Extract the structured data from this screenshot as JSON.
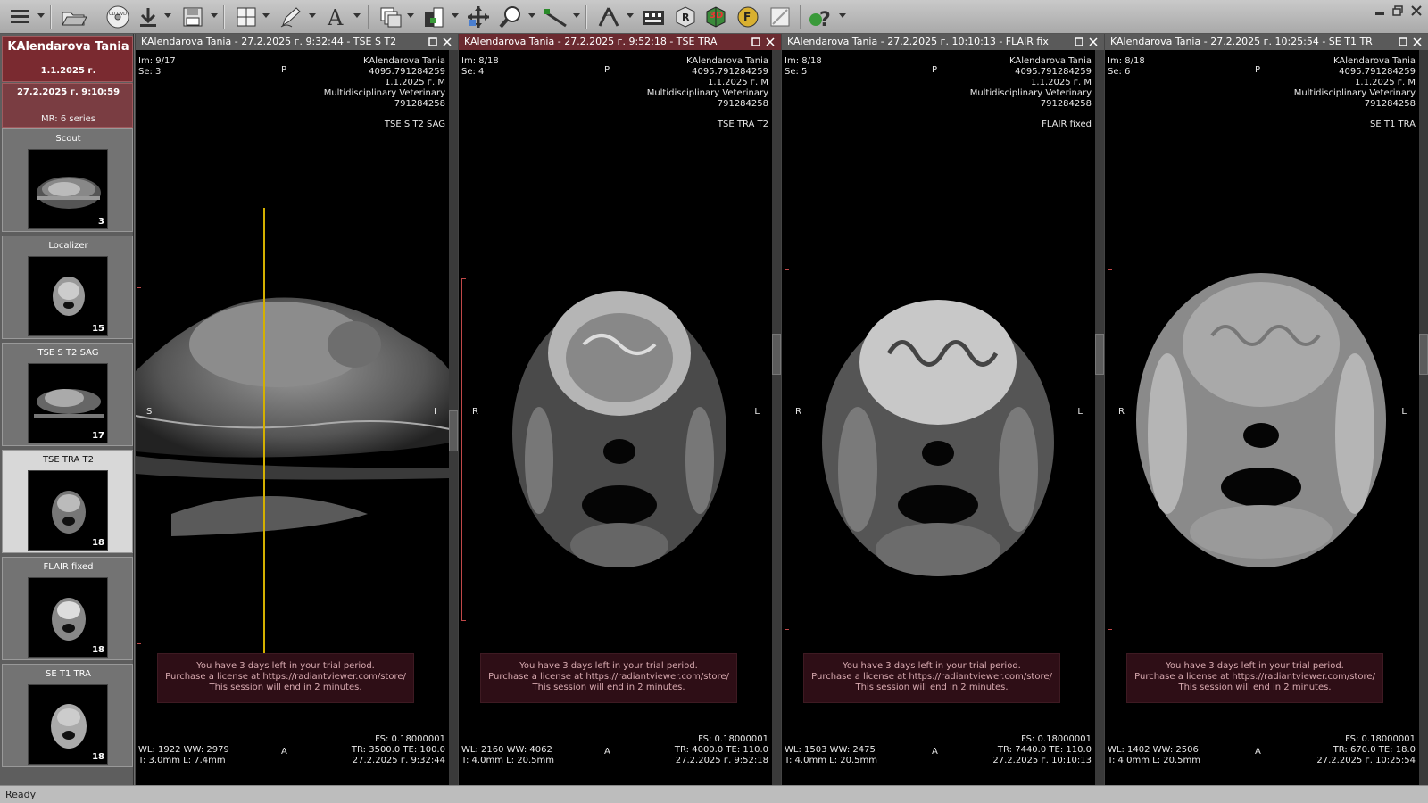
{
  "toolbar": {
    "icons": [
      "menu-icon",
      "open-folder-icon",
      "cd-dvd-icon",
      "download-icon",
      "save-icon",
      "layout-grid-icon",
      "annotate-pen-icon",
      "text-icon",
      "series-stack-icon",
      "window-level-icon",
      "pan-icon",
      "zoom-icon",
      "measure-ruler-icon",
      "angle-icon",
      "cine-icon",
      "mpr-icon",
      "3d-icon",
      "fusion-icon",
      "reset-icon",
      "help-icon"
    ],
    "cd_label": "CD DVD",
    "mpr_label": "R",
    "threed_label": "3D",
    "fusion_label": "F"
  },
  "sidebar": {
    "patient_name": "KAlendarova Tania",
    "patient_dob": "1.1.2025 г.",
    "study_datetime": "27.2.2025 г. 9:10:59",
    "study_series": "MR: 6 series",
    "series": [
      {
        "label": "Scout",
        "count": "3"
      },
      {
        "label": "Localizer",
        "count": "15"
      },
      {
        "label": "TSE S T2 SAG",
        "count": "17"
      },
      {
        "label": "TSE TRA  T2",
        "count": "18"
      },
      {
        "label": "FLAIR fixed",
        "count": "18"
      },
      {
        "label": "SE T1 TRA",
        "count": "18"
      }
    ]
  },
  "trial_message": {
    "line1": "You have 3 days left in your trial period.",
    "line2": "Purchase a license at https://radiantviewer.com/store/",
    "line3": "This session will end in 2 minutes."
  },
  "viewports": [
    {
      "title": "KAlendarova Tania - 27.2.2025 г. 9:32:44 - TSE S T2",
      "im": "Im: 9/17",
      "se": "Se: 3",
      "top_orient": "P",
      "name": "KAlendarova Tania",
      "id": "4095.791284259",
      "dob_sex": "1.1.2025 г. M",
      "institution": "Multidisciplinary Veterinary",
      "acc": "791284258",
      "series_desc": "TSE S T2 SAG",
      "left_orient": "S",
      "right_orient": "I",
      "bottom_orient": "A",
      "fs": "FS: 0.18000001",
      "wl": "WL: 1922 WW: 2979",
      "tr": "TR: 3500.0 TE: 100.0",
      "t": "T: 3.0mm L: 7.4mm",
      "date": "27.2.2025 г. 9:32:44"
    },
    {
      "title": "KAlendarova Tania - 27.2.2025 г. 9:52:18 - TSE TRA",
      "im": "Im: 8/18",
      "se": "Se: 4",
      "top_orient": "P",
      "name": "KAlendarova Tania",
      "id": "4095.791284259",
      "dob_sex": "1.1.2025 г. M",
      "institution": "Multidisciplinary Veterinary",
      "acc": "791284258",
      "series_desc": "TSE TRA  T2",
      "left_orient": "R",
      "right_orient": "L",
      "bottom_orient": "A",
      "fs": "FS: 0.18000001",
      "wl": "WL: 2160 WW: 4062",
      "tr": "TR: 4000.0 TE: 110.0",
      "t": "T: 4.0mm L: 20.5mm",
      "date": "27.2.2025 г. 9:52:18"
    },
    {
      "title": "KAlendarova Tania - 27.2.2025 г. 10:10:13 - FLAIR fix",
      "im": "Im: 8/18",
      "se": "Se: 5",
      "top_orient": "P",
      "name": "KAlendarova Tania",
      "id": "4095.791284259",
      "dob_sex": "1.1.2025 г. M",
      "institution": "Multidisciplinary Veterinary",
      "acc": "791284258",
      "series_desc": "FLAIR fixed",
      "left_orient": "R",
      "right_orient": "L",
      "bottom_orient": "A",
      "fs": "FS: 0.18000001",
      "wl": "WL: 1503 WW: 2475",
      "tr": "TR: 7440.0 TE: 110.0",
      "t": "T: 4.0mm L: 20.5mm",
      "date": "27.2.2025 г. 10:10:13"
    },
    {
      "title": "KAlendarova Tania - 27.2.2025 г. 10:25:54 - SE T1 TR",
      "im": "Im: 8/18",
      "se": "Se: 6",
      "top_orient": "P",
      "name": "KAlendarova Tania",
      "id": "4095.791284259",
      "dob_sex": "1.1.2025 г. M",
      "institution": "Multidisciplinary Veterinary",
      "acc": "791284258",
      "series_desc": "SE T1 TRA",
      "left_orient": "R",
      "right_orient": "L",
      "bottom_orient": "A",
      "fs": "FS: 0.18000001",
      "wl": "WL: 1402 WW: 2506",
      "tr": "TR: 670.0 TE: 18.0",
      "t": "T: 4.0mm L: 20.5mm",
      "date": "27.2.2025 г. 10:25:54"
    }
  ],
  "status": "Ready",
  "colors": {
    "active_title": "#6b2a30",
    "patient_card": "#7a2a30",
    "localizer_line": "#d4b000",
    "ruler": "#c04848"
  }
}
